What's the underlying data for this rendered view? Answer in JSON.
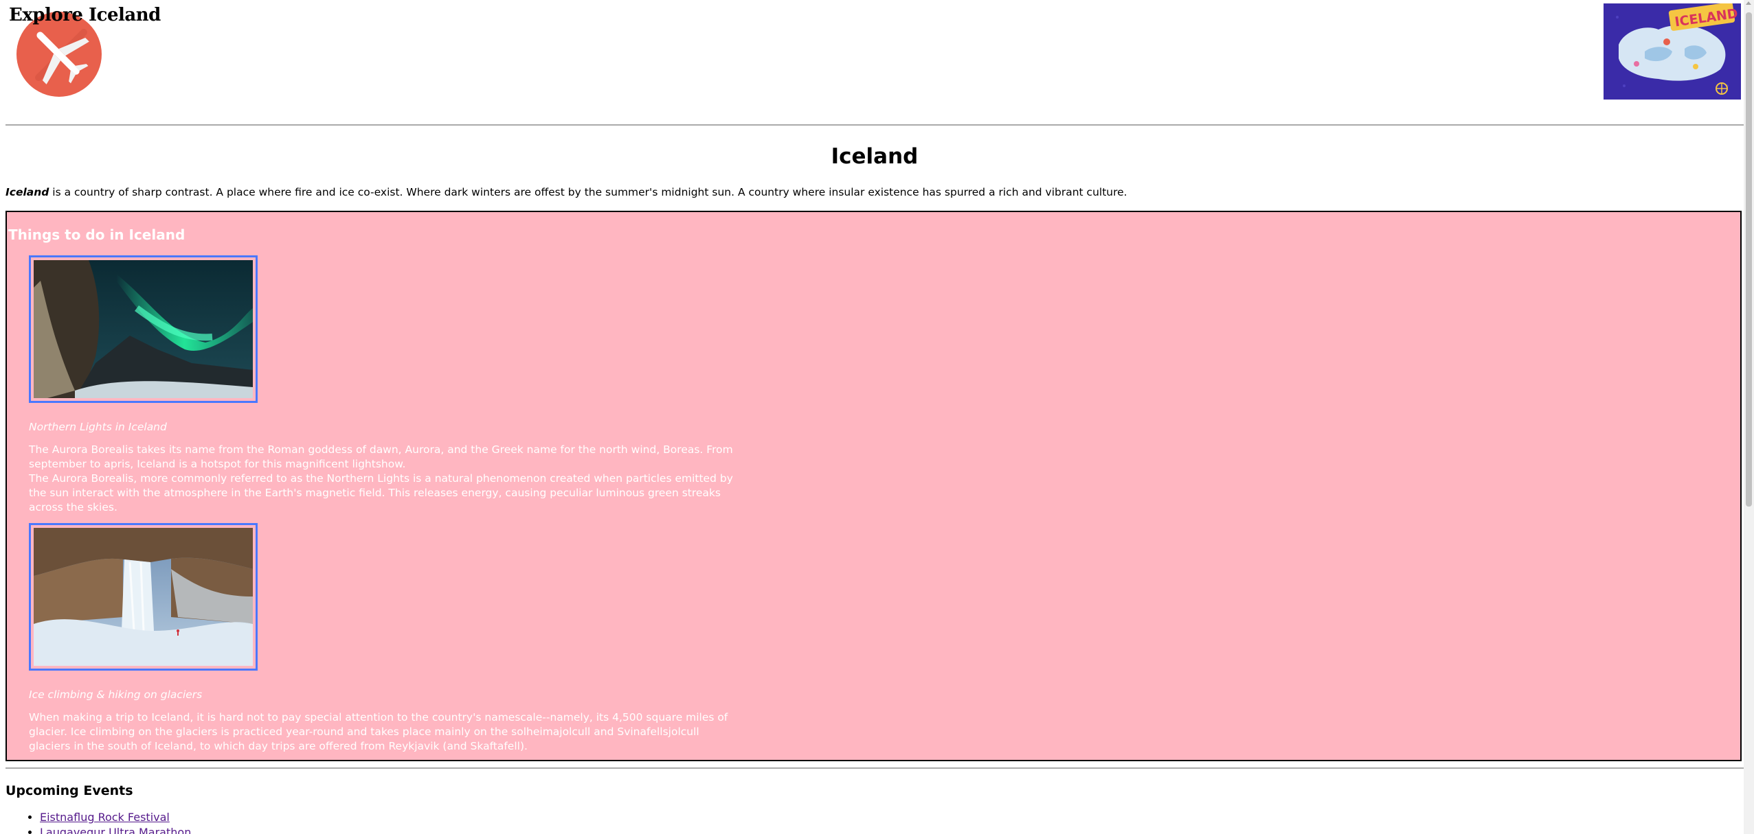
{
  "header": {
    "site_title": "Explore Iceland",
    "logo_icon": "airplane-icon",
    "map_label": "ICELAND"
  },
  "main": {
    "heading": "Iceland",
    "intro_lead": "Iceland",
    "intro_rest": " is a country of sharp contrast. A place where fire and ice co-exist. Where dark winters are offest by the summer's midnight sun. A country where insular existence has spurred a rich and vibrant culture."
  },
  "things_to_do": {
    "title": "Things to do in Iceland",
    "items": [
      {
        "caption": "Northern Lights in Iceland",
        "description": "The Aurora Borealis takes its name from the Roman goddess of dawn, Aurora, and the Greek name for the north wind, Boreas. From september to apris, Iceland is a hotspot for this magnificent lightshow.\nThe Aurora Borealis, more commonly referred to as the Northern Lights is a natural phenomenon created when particles emitted by the sun interact with the atmosphere in the Earth's magnetic field. This releases energy, causing peculiar luminous green streaks across the skies."
      },
      {
        "caption": "Ice climbing & hiking on glaciers",
        "description": "When making a trip to Iceland, it is hard not to pay special attention to the country's namescale--namely, its 4,500 square miles of glacier. Ice climbing on the glaciers is practiced year-round and takes place mainly on the solheimajolcull and Svinafellsjolcull glaciers in the south of Iceland, to which day trips are offered from Reykjavik (and Skaftafell)."
      }
    ]
  },
  "events": {
    "title": "Upcoming Events",
    "items": [
      "Eistnaflug Rock Festival",
      "Laugavegur Ultra Marathon"
    ]
  },
  "colors": {
    "panel_bg": "#ffb6c1",
    "photo_border": "#4a78ff",
    "logo_red": "#e8604c",
    "link_visited": "#551a8b"
  }
}
